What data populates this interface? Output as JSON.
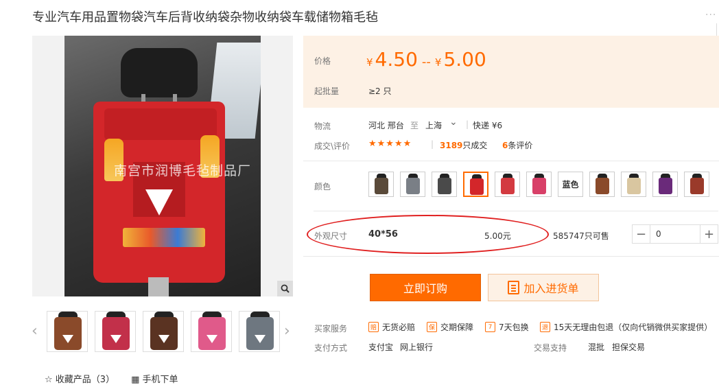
{
  "product": {
    "title": "专业汽车用品置物袋汽车后背收纳袋杂物收纳袋车载储物箱毛毡",
    "watermark": "南宫市润博毛毡制品厂"
  },
  "header": {
    "more_dots": "···"
  },
  "gallery": {
    "zoom_icon": "magnifier-icon",
    "prev_arrow": "‹",
    "next_arrow": "›",
    "thumbnail_colors": [
      "#8a4a2a",
      "#c2304a",
      "#5a3322",
      "#e05a8a",
      "#6e7780"
    ]
  },
  "footer": {
    "favorite_label": "收藏产品（3）",
    "favorite_icon": "☆",
    "mobile_label": "手机下单",
    "mobile_icon": "▦"
  },
  "price": {
    "label": "价格",
    "currency": "¥",
    "low": "4.50",
    "range_sep": "--",
    "high": "5.00"
  },
  "min_order": {
    "label": "起批量",
    "value": "≥2 只"
  },
  "logistics": {
    "label": "物流",
    "origin": "河北 邢台",
    "to": "至",
    "destination": "上海",
    "dropdown_icon": "⌄",
    "divider": "|",
    "shipping": "快递 ¥6"
  },
  "deals": {
    "label": "成交\\评价",
    "stars": "★★★★★",
    "divider": "|",
    "deal_count": "3189",
    "deal_suffix": "只成交",
    "review_count": "6",
    "review_suffix": "条评价"
  },
  "color": {
    "label": "颜色",
    "swatches": [
      "#5a4a3a",
      "#7a7f86",
      "#4a4a4a",
      "#d3262a",
      "#d33a40",
      "#d84068",
      "#ffffff",
      "#8a4a2a",
      "#d9c6a0",
      "#6a2a7a",
      "#9a3a2a"
    ],
    "selected_index": 3,
    "text_swatch_label": "蓝色"
  },
  "size": {
    "label": "外观尺寸",
    "value": "40*56",
    "price": "5.00元",
    "stock": "585747只可售",
    "qty_minus": "−",
    "qty_value": "0",
    "qty_plus": "+"
  },
  "actions": {
    "buy": "立即订购",
    "cart": "加入进货单"
  },
  "services": {
    "label": "买家服务",
    "items": [
      {
        "icon": "赔",
        "text": "无货必赔"
      },
      {
        "icon": "保",
        "text": "交期保障"
      },
      {
        "icon": "7",
        "text": "7天包换"
      },
      {
        "icon": "退",
        "text": "15天无理由包退（仅向代销微供买家提供）"
      }
    ]
  },
  "payment": {
    "label": "支付方式",
    "alipay": "支付宝",
    "bank": "网上银行"
  },
  "trade": {
    "label": "交易支持",
    "mixed": "混批",
    "guarantee": "担保交易"
  },
  "accent_color": "#ff6a00"
}
